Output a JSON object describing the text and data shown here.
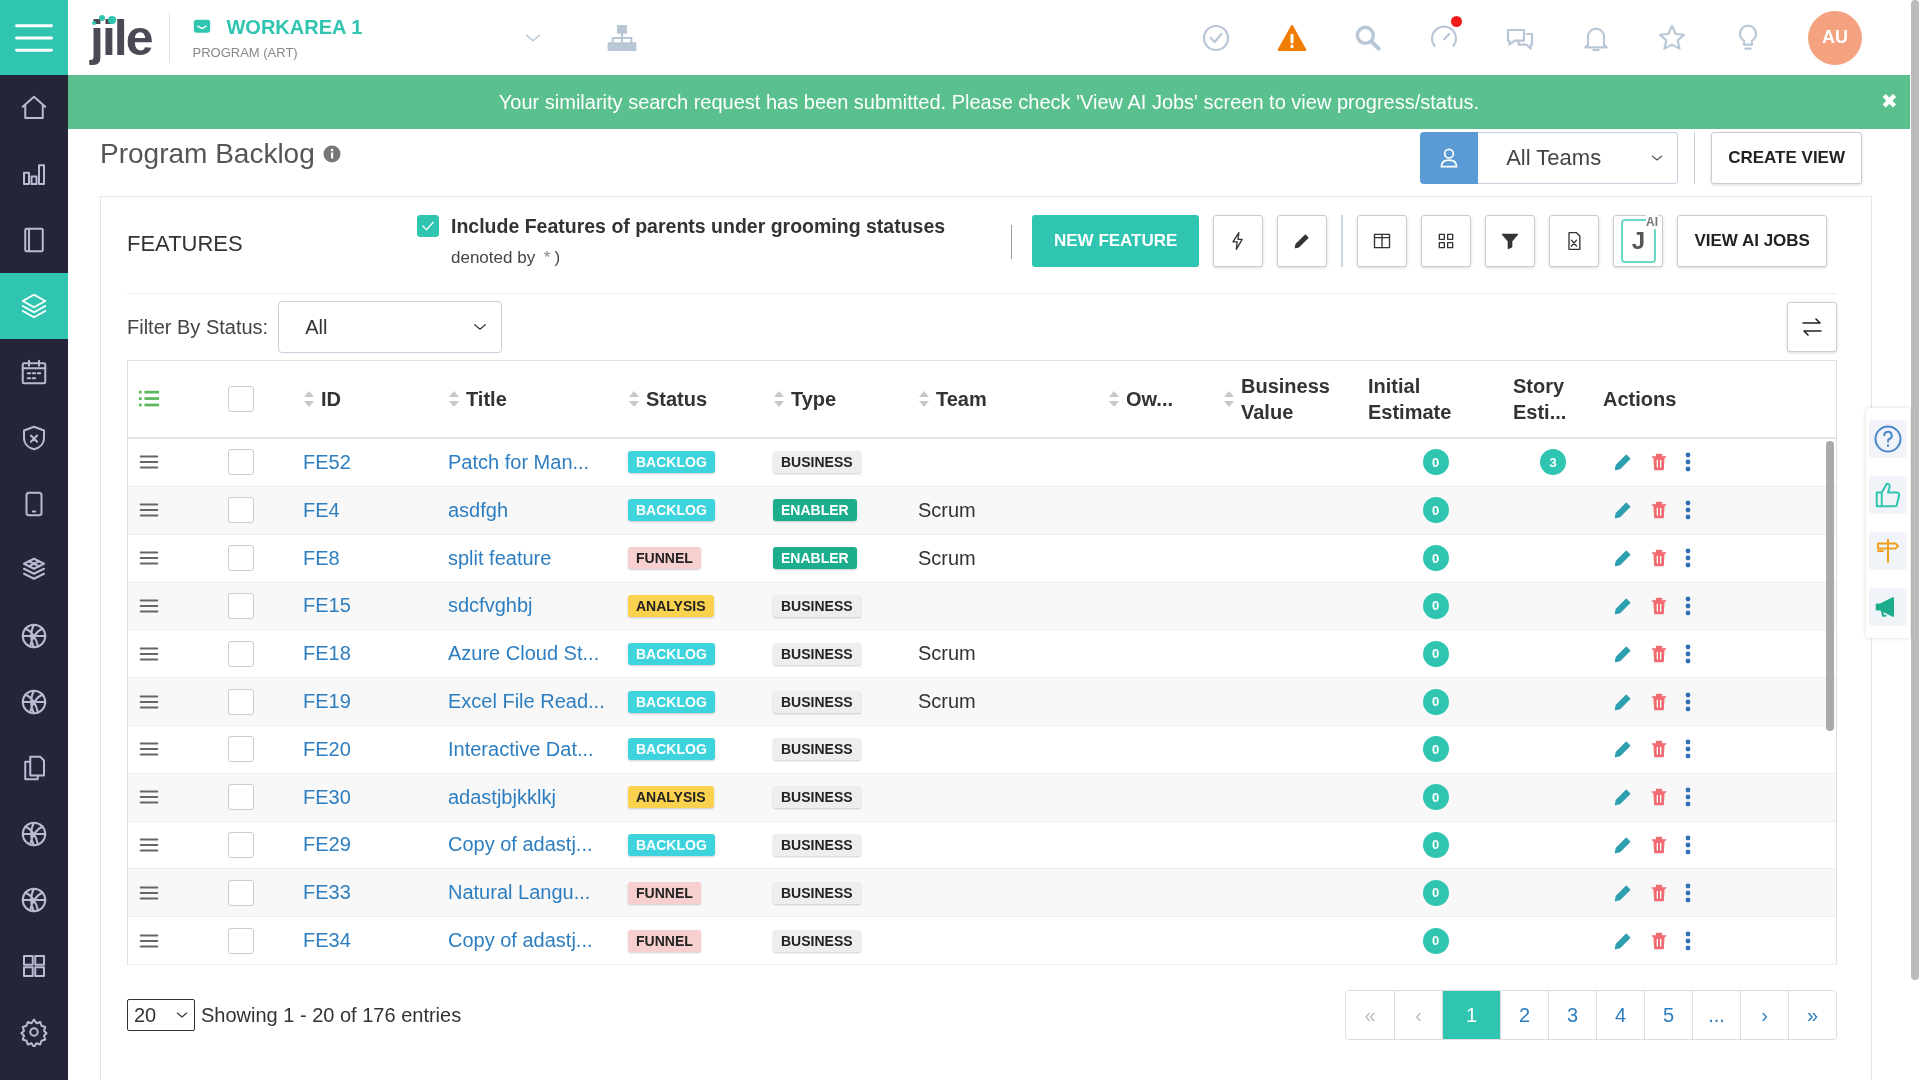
{
  "header": {
    "logo": "jile",
    "workarea": "WORKAREA 1",
    "workarea_type": "PROGRAM (ART)",
    "icons": [
      {
        "kind": "check"
      },
      {
        "kind": "warning"
      },
      {
        "kind": "search"
      },
      {
        "kind": "speed",
        "alert": true
      },
      {
        "kind": "chat"
      },
      {
        "kind": "bell"
      },
      {
        "kind": "star"
      },
      {
        "kind": "bulb"
      }
    ],
    "avatar": "AU"
  },
  "sidebar": {
    "items": [
      {
        "kind": "home",
        "selected": false
      },
      {
        "kind": "chart",
        "selected": false
      },
      {
        "kind": "book",
        "selected": false
      },
      {
        "kind": "layers",
        "selected": true
      },
      {
        "kind": "calendar",
        "selected": false
      },
      {
        "kind": "shield",
        "selected": false
      },
      {
        "kind": "tablet",
        "selected": false
      },
      {
        "kind": "boxes",
        "selected": false
      },
      {
        "kind": "ball",
        "selected": false
      },
      {
        "kind": "ball",
        "selected": false
      },
      {
        "kind": "docs",
        "selected": false
      },
      {
        "kind": "ball",
        "selected": false
      },
      {
        "kind": "ball",
        "selected": false
      },
      {
        "kind": "grid",
        "selected": false
      },
      {
        "kind": "gear",
        "selected": false
      }
    ]
  },
  "notification": {
    "message": "Your similarity search request has been submitted. Please check 'View AI Jobs' screen to view progress/status.",
    "close": "✖"
  },
  "page_title": "Program Backlog",
  "team_filter": {
    "value": "All Teams"
  },
  "create_view": "CREATE VIEW",
  "features": {
    "title": "FEATURES",
    "include_parents": {
      "checked": true,
      "label": "Include Features of parents under grooming statuses",
      "note_before": "denoted by",
      "note_mark": "*",
      "note_after": ")"
    },
    "new_button": "NEW FEATURE",
    "view_ai_jobs": "VIEW AI JOBS",
    "ai_logo": {
      "letter": "J",
      "sup": "AI"
    },
    "filter": {
      "label": "Filter By Status:",
      "value": "All"
    },
    "select_all_checked": false,
    "columns": [
      "ID",
      "Title",
      "Status",
      "Type",
      "Team",
      "Ow...",
      "Business Value",
      "Initial Estimate",
      "Story Esti...",
      "Actions"
    ],
    "rows": [
      {
        "id": "FE52",
        "title": "Patch for Man...",
        "status": {
          "text": "BACKLOG",
          "kind": "backlog"
        },
        "type": {
          "text": "BUSINESS",
          "kind": "business"
        },
        "initial_estimate": "0",
        "story_estimate": "3"
      },
      {
        "id": "FE4",
        "title": "asdfgh",
        "status": {
          "text": "BACKLOG",
          "kind": "backlog"
        },
        "type": {
          "text": "ENABLER",
          "kind": "enabler"
        },
        "team": "Scrum",
        "initial_estimate": "0"
      },
      {
        "id": "FE8",
        "title": "split feature",
        "status": {
          "text": "FUNNEL",
          "kind": "funnel"
        },
        "type": {
          "text": "ENABLER",
          "kind": "enabler"
        },
        "team": "Scrum",
        "initial_estimate": "0"
      },
      {
        "id": "FE15",
        "title": "sdcfvghbj",
        "status": {
          "text": "ANALYSIS",
          "kind": "analysis"
        },
        "type": {
          "text": "BUSINESS",
          "kind": "business"
        },
        "initial_estimate": "0"
      },
      {
        "id": "FE18",
        "title": "Azure Cloud St...",
        "status": {
          "text": "BACKLOG",
          "kind": "backlog"
        },
        "type": {
          "text": "BUSINESS",
          "kind": "business"
        },
        "team": "Scrum",
        "initial_estimate": "0"
      },
      {
        "id": "FE19",
        "title": "Excel File Read...",
        "status": {
          "text": "BACKLOG",
          "kind": "backlog"
        },
        "type": {
          "text": "BUSINESS",
          "kind": "business"
        },
        "team": "Scrum",
        "initial_estimate": "0"
      },
      {
        "id": "FE20",
        "title": "Interactive Dat...",
        "status": {
          "text": "BACKLOG",
          "kind": "backlog"
        },
        "type": {
          "text": "BUSINESS",
          "kind": "business"
        },
        "initial_estimate": "0"
      },
      {
        "id": "FE30",
        "title": "adastjbjkklkj",
        "status": {
          "text": "ANALYSIS",
          "kind": "analysis"
        },
        "type": {
          "text": "BUSINESS",
          "kind": "business"
        },
        "initial_estimate": "0"
      },
      {
        "id": "FE29",
        "title": "Copy of adastj...",
        "status": {
          "text": "BACKLOG",
          "kind": "backlog"
        },
        "type": {
          "text": "BUSINESS",
          "kind": "business"
        },
        "initial_estimate": "0"
      },
      {
        "id": "FE33",
        "title": "Natural Langu...",
        "status": {
          "text": "FUNNEL",
          "kind": "funnel"
        },
        "type": {
          "text": "BUSINESS",
          "kind": "business"
        },
        "initial_estimate": "0"
      },
      {
        "id": "FE34",
        "title": "Copy of adastj...",
        "status": {
          "text": "FUNNEL",
          "kind": "funnel"
        },
        "type": {
          "text": "BUSINESS",
          "kind": "business"
        },
        "initial_estimate": "0"
      }
    ],
    "page_size": "20",
    "summary": "Showing 1 - 20 of 176 entries",
    "row_checked": [
      false,
      false,
      false,
      false,
      false,
      false,
      false,
      false,
      false,
      false,
      false
    ],
    "pagination": [
      {
        "label": "«",
        "selected": false,
        "disabled": true
      },
      {
        "label": "‹",
        "selected": false,
        "disabled": true
      },
      {
        "label": "1",
        "selected": true,
        "disabled": false
      },
      {
        "label": "2",
        "selected": false,
        "disabled": false
      },
      {
        "label": "3",
        "selected": false,
        "disabled": false
      },
      {
        "label": "4",
        "selected": false,
        "disabled": false
      },
      {
        "label": "5",
        "selected": false,
        "disabled": false
      },
      {
        "label": "...",
        "selected": false,
        "disabled": false
      },
      {
        "label": "›",
        "selected": false,
        "disabled": false
      },
      {
        "label": "»",
        "selected": false,
        "disabled": false
      }
    ]
  },
  "side_panel": [
    {
      "kind": "help"
    },
    {
      "kind": "like"
    },
    {
      "kind": "sign"
    },
    {
      "kind": "megaphone"
    }
  ]
}
